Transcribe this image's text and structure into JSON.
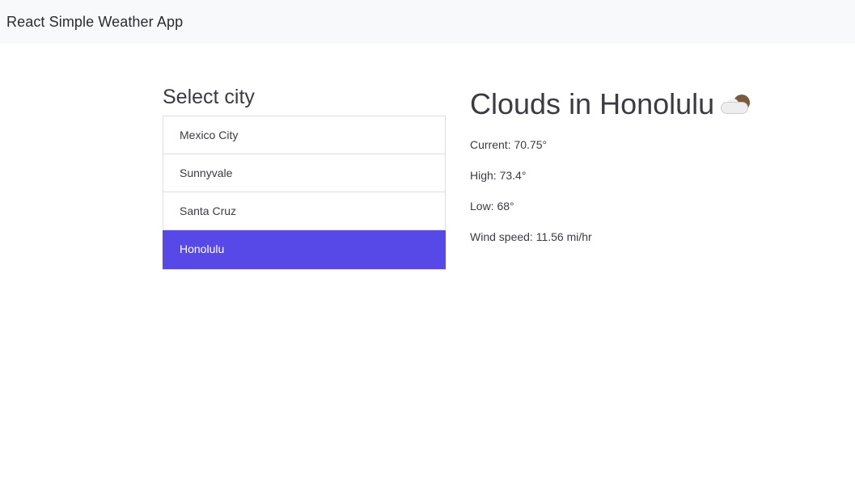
{
  "app": {
    "title": "React Simple Weather App"
  },
  "city_selector": {
    "title": "Select city",
    "items": [
      {
        "label": "Mexico City",
        "active": false
      },
      {
        "label": "Sunnyvale",
        "active": false
      },
      {
        "label": "Santa Cruz",
        "active": false
      },
      {
        "label": "Honolulu",
        "active": true
      }
    ]
  },
  "weather": {
    "title": "Clouds in Honolulu",
    "icon": "sun-behind-cloud-icon",
    "current": "Current: 70.75°",
    "high": "High: 73.4°",
    "low": "Low: 68°",
    "wind": "Wind speed: 11.56 mi/hr"
  },
  "colors": {
    "accent": "#5649e8",
    "navbar_bg": "#f8f9fa"
  }
}
